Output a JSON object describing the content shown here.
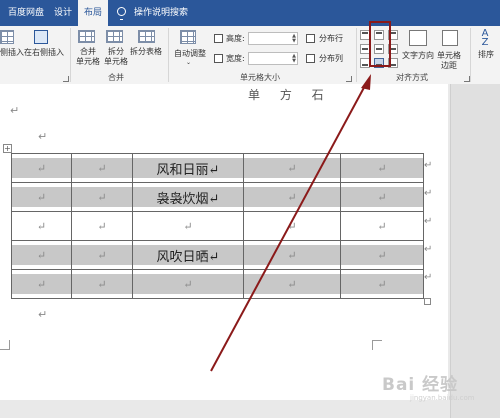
{
  "tabs": [
    {
      "label": "百度网盘",
      "active": false
    },
    {
      "label": "设计",
      "active": false
    },
    {
      "label": "布局",
      "active": true
    },
    {
      "label": "操作说明搜索",
      "active": false
    }
  ],
  "ribbon": {
    "insert_left_fragment": "侧插入",
    "insert_right": "在右侧插入",
    "merge_cells": [
      "合并",
      "单元格"
    ],
    "split_cells": [
      "拆分",
      "单元格"
    ],
    "split_table": "拆分表格",
    "merge_group": "合并",
    "autofit": "自动调整",
    "height_label": "高度:",
    "width_label": "宽度:",
    "height_value": "",
    "width_value": "",
    "distribute_rows": "分布行",
    "distribute_cols": "分布列",
    "cell_size_group": "单元格大小",
    "text_direction": "文字方向",
    "cell_margins": [
      "单元格",
      "边距"
    ],
    "alignment_group": "对齐方式",
    "sort": "排序",
    "sort_icon_text": "A Z"
  },
  "document": {
    "return_mark": "↵",
    "table_handle": "+",
    "cut_title": "单 方 石",
    "rows": [
      [
        "↵",
        "↵",
        "风和日丽↵",
        "↵",
        "↵"
      ],
      [
        "↵",
        "↵",
        "袅袅炊烟↵",
        "↵",
        "↵"
      ],
      [
        "↵",
        "↵",
        "↵",
        "↵",
        "↵"
      ],
      [
        "↵",
        "↵",
        "风吹日晒↵",
        "↵",
        "↵"
      ],
      [
        "↵",
        "↵",
        "↵",
        "↵",
        "↵"
      ]
    ]
  },
  "watermark": {
    "text": "Bai 经验",
    "sub": "jingyan.baidu.com"
  },
  "colors": {
    "accent": "#2b579a",
    "highlight": "#8b1a1a",
    "band": "#c8c8c8"
  }
}
